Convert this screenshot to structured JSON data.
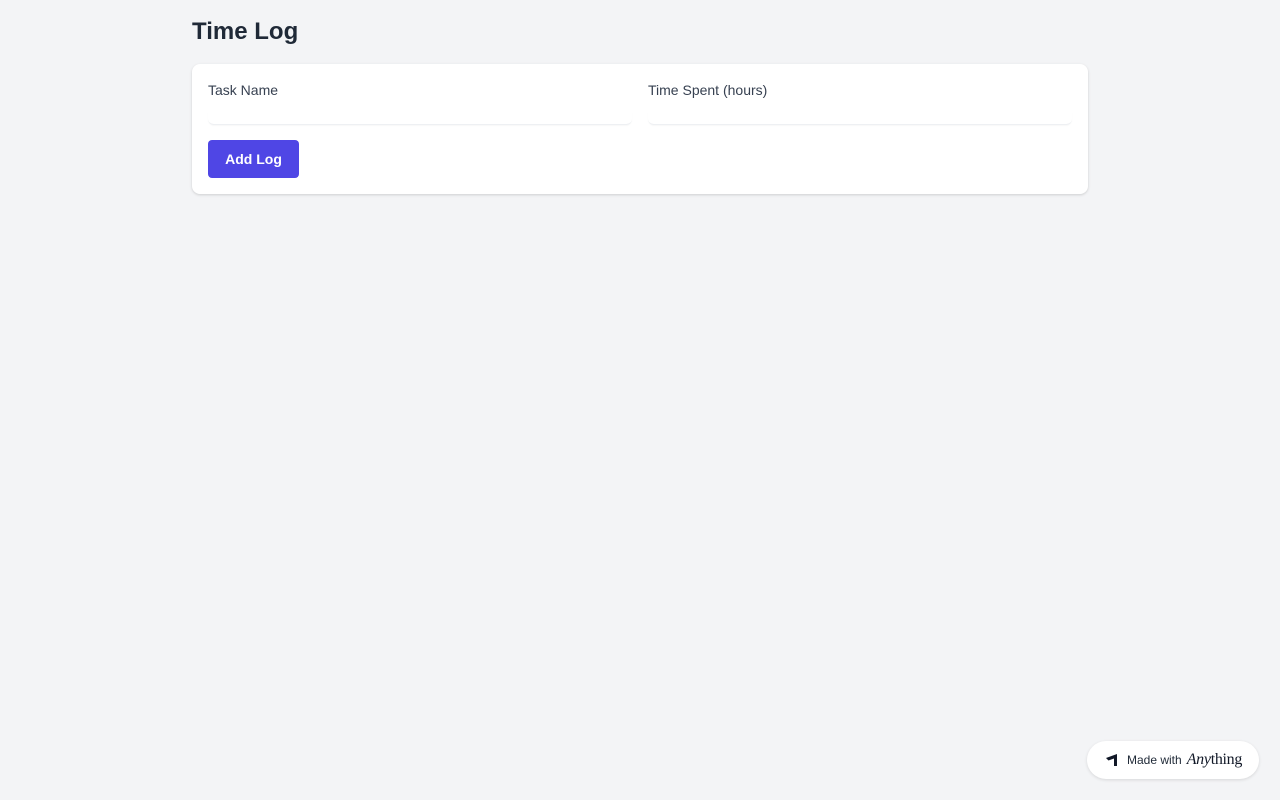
{
  "page": {
    "title": "Time Log"
  },
  "form": {
    "task_name_label": "Task Name",
    "task_name_value": "",
    "time_spent_label": "Time Spent (hours)",
    "time_spent_value": "",
    "add_button_label": "Add Log"
  },
  "badge": {
    "prefix": "Made with",
    "brand_italic": "Any",
    "brand_rest": "thing",
    "icon": "anything-logo-icon"
  },
  "colors": {
    "background": "#f3f4f6",
    "accent": "#4f46e5",
    "card": "#ffffff",
    "title": "#1f2937"
  }
}
